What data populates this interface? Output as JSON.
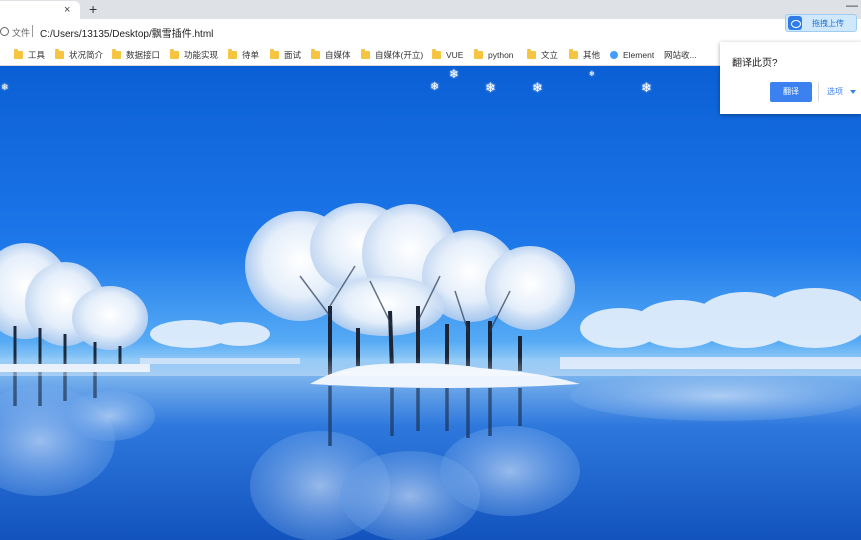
{
  "browser": {
    "tab_close": "×",
    "new_tab": "+",
    "minimize": "—",
    "security_label": "文件",
    "url": "C:/Users/13135/Desktop/飘雪插件.html"
  },
  "extension": {
    "label": "拖拽上传",
    "icon": "baidu-cloud-icon"
  },
  "bookmarks": [
    {
      "label": "工具",
      "icon": "folder-icon"
    },
    {
      "label": "状况简介",
      "icon": "folder-icon"
    },
    {
      "label": "数据接口",
      "icon": "folder-icon"
    },
    {
      "label": "功能实现",
      "icon": "folder-icon"
    },
    {
      "label": "待单",
      "icon": "folder-icon"
    },
    {
      "label": "面试",
      "icon": "folder-icon"
    },
    {
      "label": "自媒体",
      "icon": "folder-icon"
    },
    {
      "label": "自媒体(开立)",
      "icon": "folder-icon"
    },
    {
      "label": "VUE",
      "icon": "folder-icon"
    },
    {
      "label": "python",
      "icon": "folder-icon"
    },
    {
      "label": "文立",
      "icon": "folder-icon"
    },
    {
      "label": "其他",
      "icon": "folder-icon"
    },
    {
      "label": "Element",
      "icon": "element-icon"
    },
    {
      "label": "网站收...",
      "icon": "none"
    }
  ],
  "translate_popup": {
    "title": "翻译此页?",
    "translate_button": "翻译",
    "options_button": "选项"
  },
  "page": {
    "snowflake_glyph": "❄",
    "scene": "snowy trees on island reflected in lake",
    "colors": {
      "sky_top": "#0a5fd4",
      "water": "#1253bd",
      "accent": "#3b82f0"
    }
  }
}
